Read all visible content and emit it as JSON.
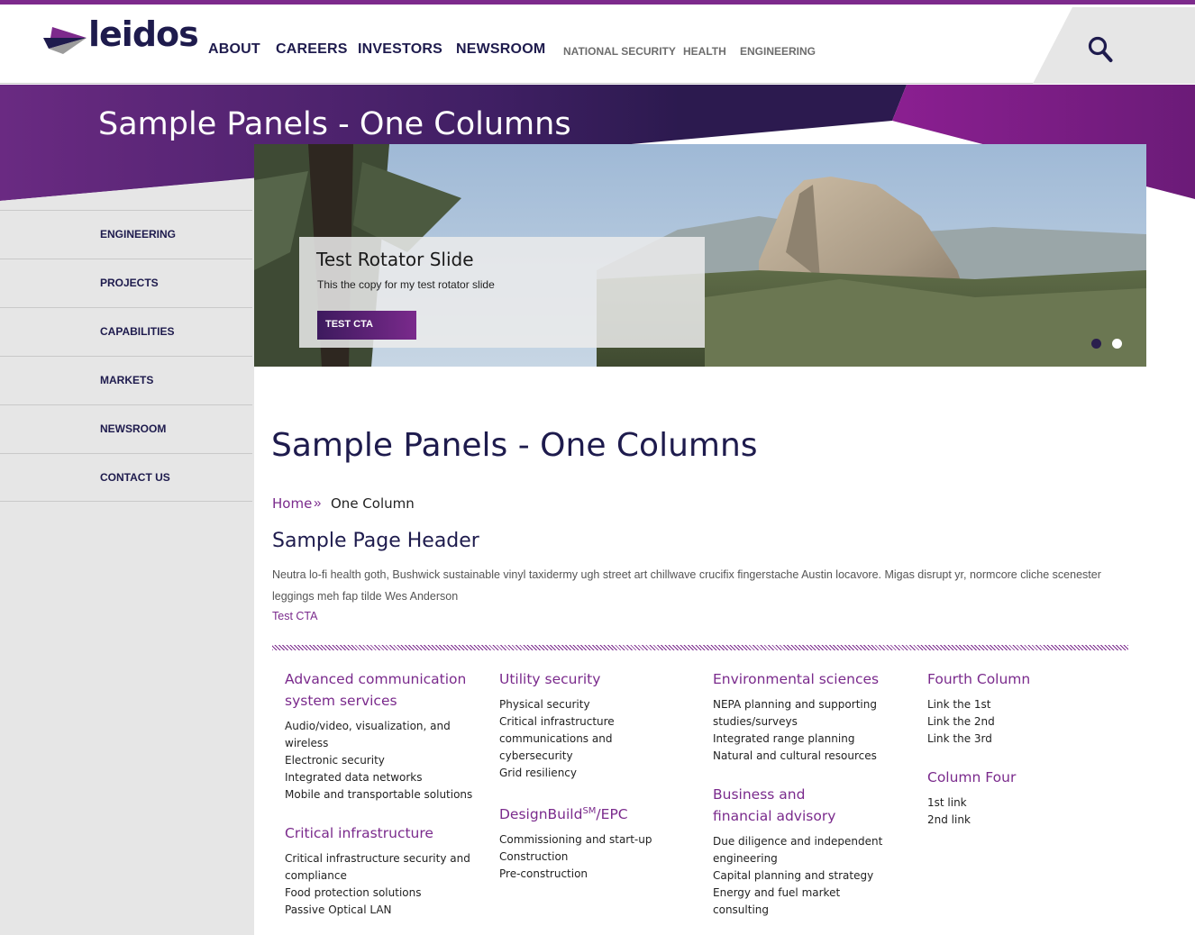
{
  "brand": {
    "logo_text": "leidos",
    "accent_color": "#7a2a8c",
    "navy_color": "#1e1b4d"
  },
  "nav": {
    "main": [
      "ABOUT",
      "CAREERS",
      "INVESTORS",
      "NEWSROOM"
    ],
    "sub": [
      "NATIONAL SECURITY",
      "HEALTH",
      "ENGINEERING"
    ],
    "search_icon": "search-icon"
  },
  "hero": {
    "title": "Sample Panels - One Columns"
  },
  "sidebar": {
    "items": [
      {
        "label": "ENGINEERING"
      },
      {
        "label": "PROJECTS"
      },
      {
        "label": "CAPABILITIES"
      },
      {
        "label": "MARKETS"
      },
      {
        "label": "NEWSROOM"
      },
      {
        "label": "CONTACT US"
      }
    ]
  },
  "rotator": {
    "title": "Test Rotator Slide",
    "copy": "This the copy for my test rotator slide",
    "cta": "TEST CTA",
    "slide_count": 2,
    "active_slide": 2
  },
  "main": {
    "title": "Sample Panels - One Columns",
    "breadcrumb": {
      "home": "Home",
      "separator": "»",
      "current": "One Column"
    },
    "header": "Sample Page Header",
    "body": "Neutra lo-fi health goth, Bushwick sustainable vinyl taxidermy ugh street art chillwave crucifix fingerstache Austin locavore. Migas disrupt yr, normcore cliche scenester leggings meh fap tilde Wes Anderson",
    "cta": "Test CTA"
  },
  "columns": [
    {
      "groups": [
        {
          "title": "Advanced communication system services",
          "links": [
            "Audio/video, visualization, and wireless",
            "Electronic security",
            "Integrated data networks",
            "Mobile and transportable solutions"
          ]
        },
        {
          "title": "Critical infrastructure",
          "links": [
            "Critical infrastructure security and compliance",
            "Food protection solutions",
            "Passive Optical LAN"
          ]
        }
      ]
    },
    {
      "groups": [
        {
          "title": "Utility security",
          "links": [
            "Physical security",
            "Critical infrastructure communications and cybersecurity",
            "Grid resiliency"
          ]
        },
        {
          "title_main": "DesignBuild",
          "title_sup": "SM",
          "title_tail": "/EPC",
          "links": [
            "Commissioning and start-up",
            "Construction",
            "Pre-construction"
          ]
        }
      ]
    },
    {
      "groups": [
        {
          "title": "Environmental sciences",
          "links": [
            "NEPA planning and supporting studies/surveys",
            "Integrated range planning",
            "Natural and cultural resources"
          ]
        },
        {
          "title": "Business and financial advisory",
          "links": [
            "Due diligence and independent engineering",
            "Capital planning and strategy",
            "Energy and fuel market consulting"
          ]
        }
      ]
    },
    {
      "groups": [
        {
          "title": "Fourth Column",
          "links": [
            "Link the 1st",
            "Link the 2nd",
            "Link the 3rd"
          ]
        },
        {
          "title": "Column Four",
          "links": [
            "1st link",
            "2nd link"
          ]
        }
      ]
    }
  ]
}
